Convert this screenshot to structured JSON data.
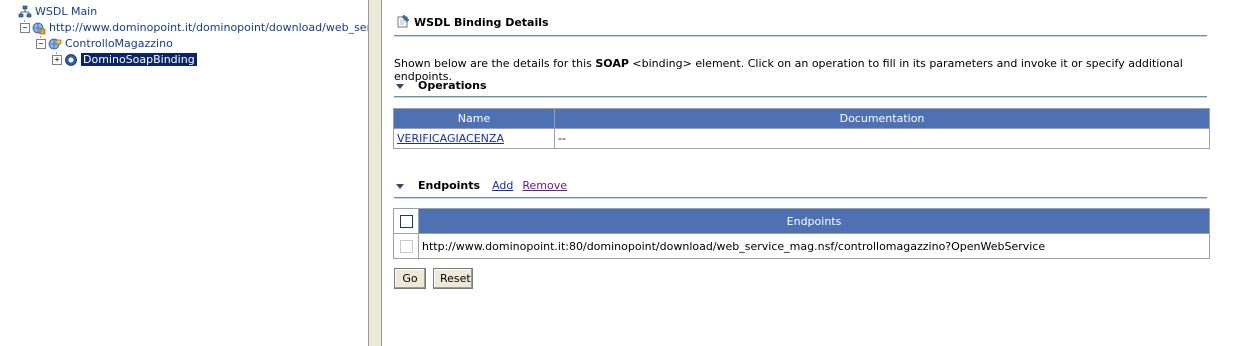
{
  "tree": {
    "items": [
      {
        "label": "WSDL Main",
        "icon": "hierarchy-icon"
      },
      {
        "label": "http://www.dominopoint.it/dominopoint/download/web_service_m",
        "icon": "service-icon",
        "expander": "−"
      },
      {
        "label": "ControlloMagazzino",
        "icon": "port-icon",
        "expander": "−"
      },
      {
        "label": "DominoSoapBinding",
        "icon": "binding-icon",
        "expander": "+"
      }
    ]
  },
  "details": {
    "title": "WSDL Binding Details",
    "intro_prefix": "Shown below are the details for this ",
    "intro_bold": "SOAP",
    "intro_suffix": " <binding> element. Click on an operation to fill in its parameters and invoke it or specify additional endpoints.",
    "operations": {
      "heading": "Operations",
      "columns": [
        "Name",
        "Documentation"
      ],
      "rows": [
        {
          "name": "VERIFICAGIACENZA",
          "documentation": "--"
        }
      ]
    },
    "endpoints": {
      "heading": "Endpoints",
      "add_label": "Add",
      "remove_label": "Remove",
      "column": "Endpoints",
      "rows": [
        {
          "url": "http://www.dominopoint.it:80/dominopoint/download/web_service_mag.nsf/controllomagazzino?OpenWebService"
        }
      ]
    },
    "go_label": "Go",
    "reset_label": "Reset"
  },
  "colors": {
    "table_header": "#4e71b3",
    "link": "#1a2bb0",
    "visited_link": "#6a1a8a",
    "selection": "#0a246a"
  }
}
